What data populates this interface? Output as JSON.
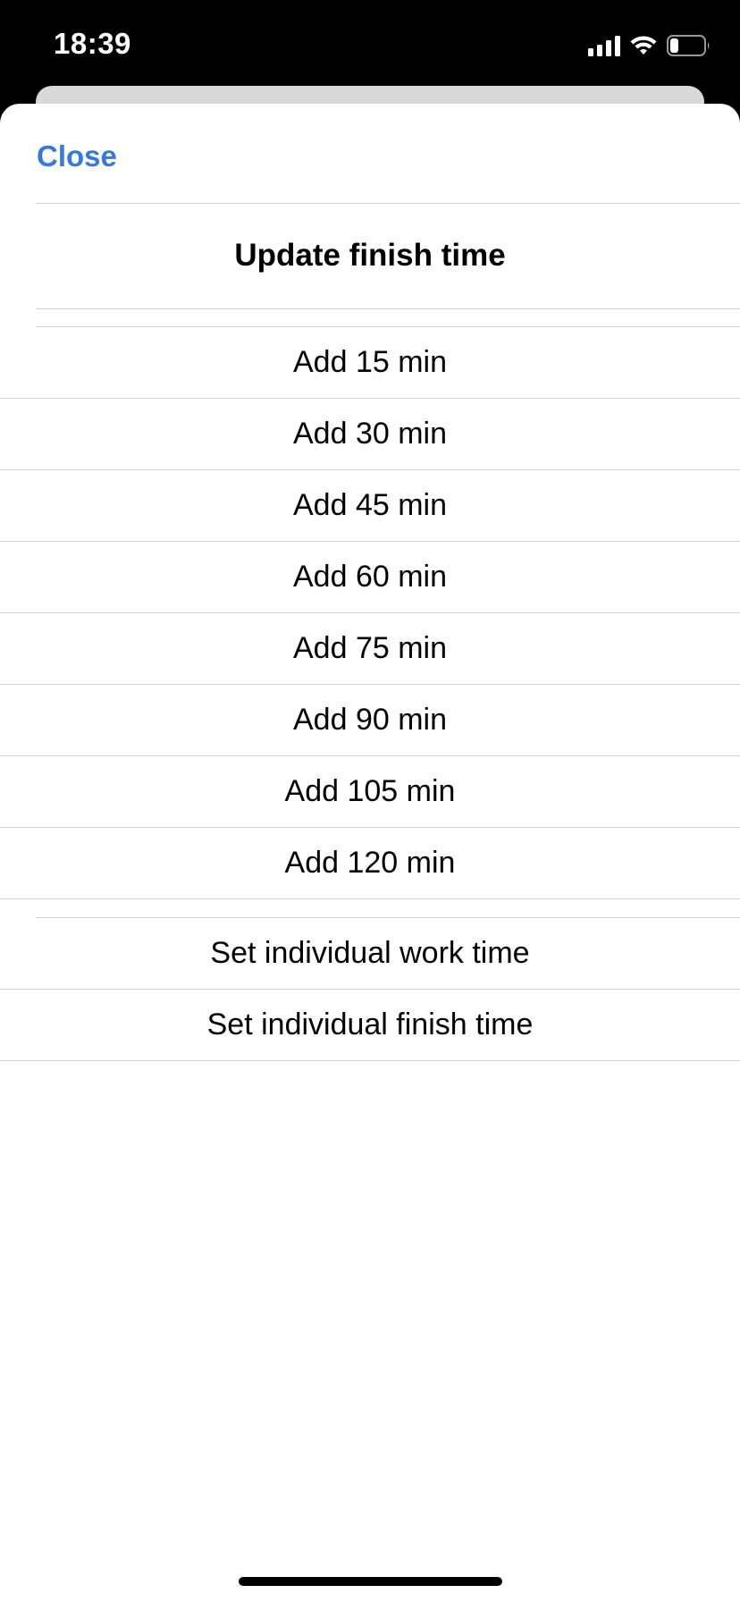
{
  "status_bar": {
    "time": "18:39",
    "signal_icon": "cellular-signal-icon",
    "wifi_icon": "wifi-icon",
    "battery_icon": "battery-low-icon"
  },
  "sheet": {
    "close_label": "Close",
    "title": "Update finish time",
    "accent_color": "#3478e0"
  },
  "duration_options": [
    {
      "label": "Add 15 min"
    },
    {
      "label": "Add 30 min"
    },
    {
      "label": "Add 45 min"
    },
    {
      "label": "Add 60 min"
    },
    {
      "label": "Add 75 min"
    },
    {
      "label": "Add 90 min"
    },
    {
      "label": "Add 105 min"
    },
    {
      "label": "Add 120 min"
    }
  ],
  "custom_options": [
    {
      "label": "Set individual work time"
    },
    {
      "label": "Set individual finish time"
    }
  ]
}
